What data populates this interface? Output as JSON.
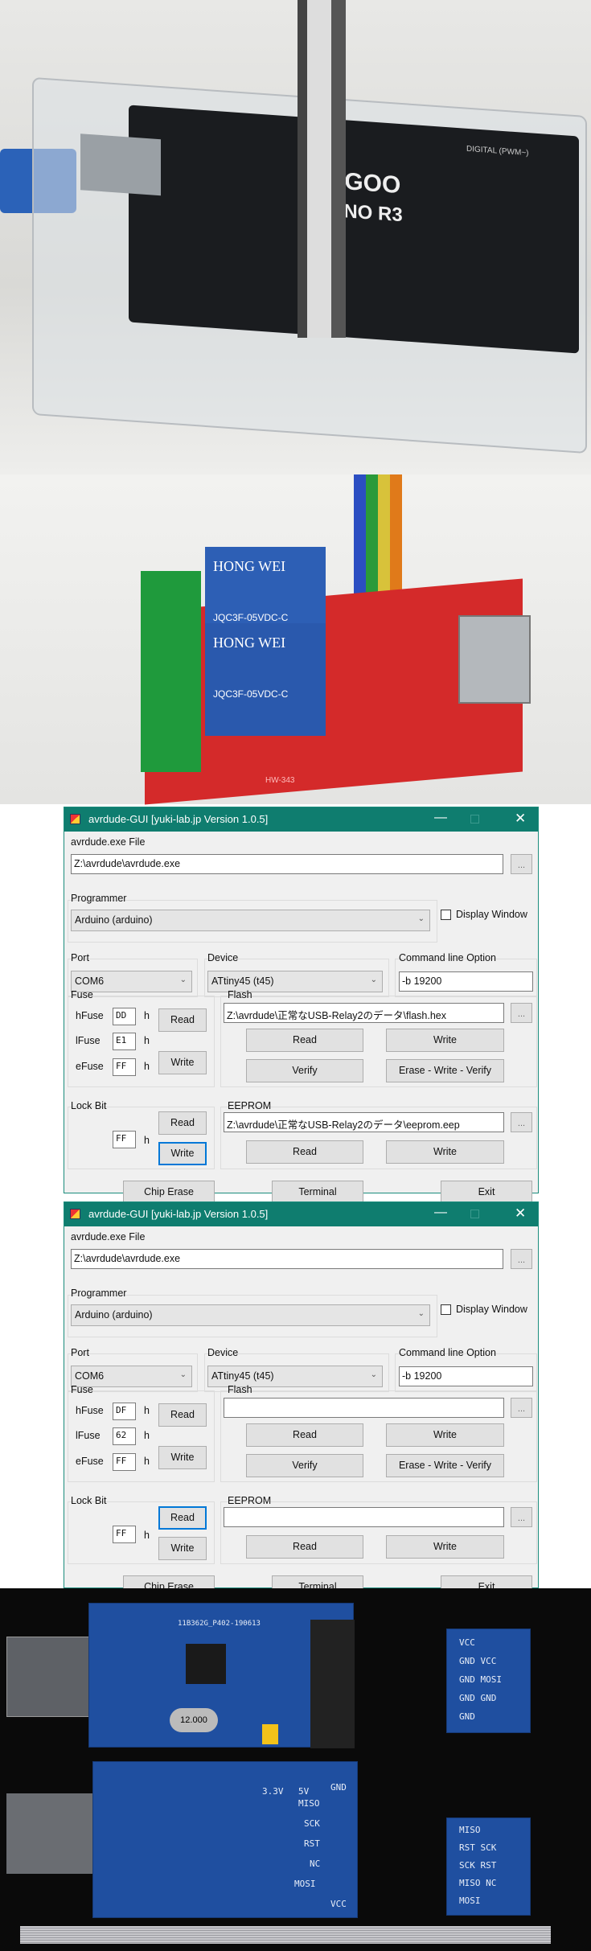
{
  "photos": {
    "arduino_board": {
      "brand": "ELEGOO",
      "model": "UNO R3",
      "digital": "DIGITAL (PWM~)"
    },
    "relay_board": {
      "relay_brand": "HONG WEI",
      "relay_model": "JQC3F-05VDC-C",
      "board_label": "HW-343"
    },
    "usbasp": {
      "pcb_id": "11B362G_P402-190613",
      "crystal": "12.000",
      "front_adapter_pins": [
        "VCC",
        "GND VCC",
        "GND MOSI",
        "GND GND",
        "GND"
      ],
      "back_pins": [
        "GND",
        "MISO",
        "SCK",
        "RST",
        "NC",
        "MOSI",
        "VCC"
      ],
      "back_adapter_pins": [
        "MISO",
        "RST SCK",
        "SCK RST",
        "MISO NC",
        "MOSI"
      ],
      "voltage_labels": [
        "3.3V",
        "5V"
      ]
    }
  },
  "windows": [
    {
      "title": "avrdude-GUI [yuki-lab.jp Version 1.0.5]",
      "avrdude_label": "avrdude.exe File",
      "avrdude_path": "Z:\\avrdude\\avrdude.exe",
      "browse": "...",
      "programmer_label": "Programmer",
      "programmer": "Arduino (arduino)",
      "display_window": "Display Window",
      "display_window_checked": false,
      "port_label": "Port",
      "port": "COM6",
      "device_label": "Device",
      "device": "ATtiny45 (t45)",
      "cmd_label": "Command line Option",
      "cmd": "-b 19200",
      "fuse_label": "Fuse",
      "hfuse_label": "hFuse",
      "hfuse": "DD",
      "lfuse_label": "lFuse",
      "lfuse": "E1",
      "efuse_label": "eFuse",
      "efuse": "FF",
      "h": "h",
      "read": "Read",
      "write": "Write",
      "verify": "Verify",
      "erase_write_verify": "Erase - Write - Verify",
      "flash_label": "Flash",
      "flash_path": "Z:\\avrdude\\正常なUSB-Relay2のデータ\\flash.hex",
      "lock_label": "Lock Bit",
      "lock": "FF",
      "eeprom_label": "EEPROM",
      "eeprom_path": "Z:\\avrdude\\正常なUSB-Relay2のデータ\\eeprom.eep",
      "chip_erase": "Chip Erase",
      "terminal": "Terminal",
      "exit": "Exit",
      "focused_button": "lock-write"
    },
    {
      "title": "avrdude-GUI [yuki-lab.jp Version 1.0.5]",
      "avrdude_label": "avrdude.exe File",
      "avrdude_path": "Z:\\avrdude\\avrdude.exe",
      "browse": "...",
      "programmer_label": "Programmer",
      "programmer": "Arduino (arduino)",
      "display_window": "Display Window",
      "display_window_checked": false,
      "port_label": "Port",
      "port": "COM6",
      "device_label": "Device",
      "device": "ATtiny45 (t45)",
      "cmd_label": "Command line Option",
      "cmd": "-b 19200",
      "fuse_label": "Fuse",
      "hfuse_label": "hFuse",
      "hfuse": "DF",
      "lfuse_label": "lFuse",
      "lfuse": "62",
      "efuse_label": "eFuse",
      "efuse": "FF",
      "h": "h",
      "read": "Read",
      "write": "Write",
      "verify": "Verify",
      "erase_write_verify": "Erase - Write - Verify",
      "flash_label": "Flash",
      "flash_path": "",
      "lock_label": "Lock Bit",
      "lock": "FF",
      "eeprom_label": "EEPROM",
      "eeprom_path": "",
      "chip_erase": "Chip Erase",
      "terminal": "Terminal",
      "exit": "Exit",
      "focused_button": "lock-read"
    }
  ],
  "colors": {
    "titlebar": "#0f7d6f",
    "focus": "#0078d7",
    "pcb_blue": "#1f4fa0",
    "relay_pcb": "#d42a2a"
  }
}
